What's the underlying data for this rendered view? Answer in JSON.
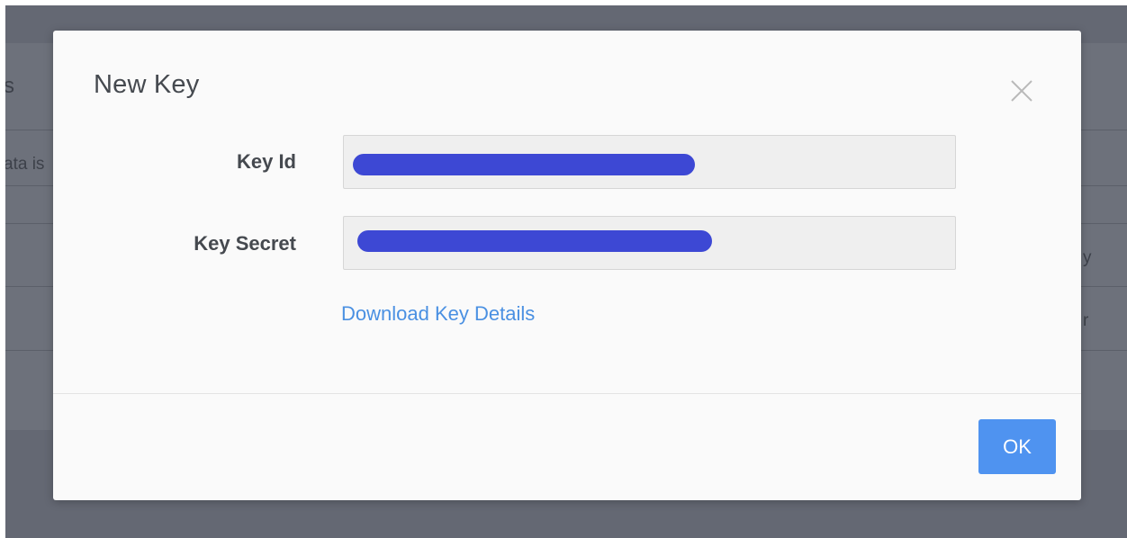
{
  "background": {
    "title_fragment": "s",
    "text_fragment_1": "ata is",
    "text_fragment_2": "y",
    "text_fragment_3": "r"
  },
  "modal": {
    "title": "New Key",
    "close_icon": "close-icon",
    "fields": [
      {
        "label": "Key Id",
        "value": "",
        "redacted": true
      },
      {
        "label": "Key Secret",
        "value": "",
        "redacted": true
      }
    ],
    "download_link": "Download Key Details",
    "ok_label": "OK"
  },
  "colors": {
    "backdrop": "#646873",
    "modal_bg": "#fafafa",
    "link": "#4a90e2",
    "primary_button": "#4f93f0",
    "redaction": "#3d48d4"
  }
}
